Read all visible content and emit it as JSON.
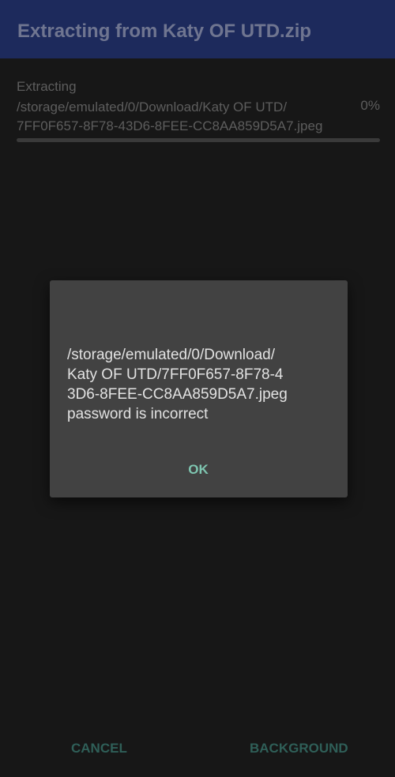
{
  "appbar": {
    "title": "Extracting from Katy OF UTD.zip"
  },
  "progress": {
    "label": "Extracting",
    "path": "/storage/emulated/0/Download/Katy OF UTD/\n7FF0F657-8F78-43D6-8FEE-CC8AA859D5A7.jpeg",
    "percent_text": "0%",
    "value": 0
  },
  "dialog": {
    "message": "/storage/emulated/0/Download/\nKaty OF UTD/7FF0F657-8F78-4\n3D6-8FEE-CC8AA859D5A7.jpeg\npassword is incorrect",
    "ok_label": "OK"
  },
  "actions": {
    "cancel_label": "CANCEL",
    "background_label": "BACKGROUND"
  },
  "colors": {
    "appbar": "#1d2a5c",
    "background": "#171717",
    "dialog": "#424242",
    "accent": "#7ec5b0"
  }
}
